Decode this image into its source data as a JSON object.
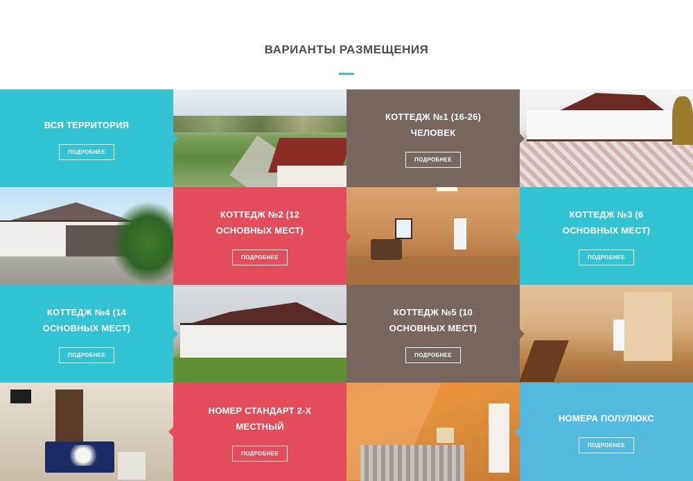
{
  "section": {
    "title": "ВАРИАНТЫ РАЗМЕЩЕНИЯ"
  },
  "colors": {
    "teal": "#32c4d2",
    "brown": "#77675f",
    "red": "#e34d5b",
    "blue": "#53b9df",
    "title": "#4a4f57"
  },
  "options": [
    {
      "title": "ВСЯ ТЕРРИТОРИЯ",
      "button": "ПОДРОБНЕЕ",
      "color": "teal"
    },
    {
      "title": "КОТТЕДЖ №1 (16-26) ЧЕЛОВЕК",
      "button": "ПОДРОБНЕЕ",
      "color": "brown"
    },
    {
      "title": "КОТТЕДЖ №2 (12 ОСНОВНЫХ МЕСТ)",
      "button": "ПОДРОБНЕЕ",
      "color": "red"
    },
    {
      "title": "КОТТЕДЖ №3 (6 ОСНОВНЫХ МЕСТ)",
      "button": "ПОДРОБНЕЕ",
      "color": "teal"
    },
    {
      "title": "КОТТЕДЖ №4 (14 ОСНОВНЫХ МЕСТ)",
      "button": "ПОДРОБНЕЕ",
      "color": "teal"
    },
    {
      "title": "КОТТЕДЖ №5 (10 ОСНОВНЫХ МЕСТ)",
      "button": "ПОДРОБНЕЕ",
      "color": "brown"
    },
    {
      "title": "НОМЕР СТАНДАРТ 2-Х МЕСТНЫЙ",
      "button": "ПОДРОБНЕЕ",
      "color": "red"
    },
    {
      "title": "НОМЕРА ПОЛУЛЮКС",
      "button": "ПОДРОБНЕЕ",
      "color": "blue"
    }
  ]
}
